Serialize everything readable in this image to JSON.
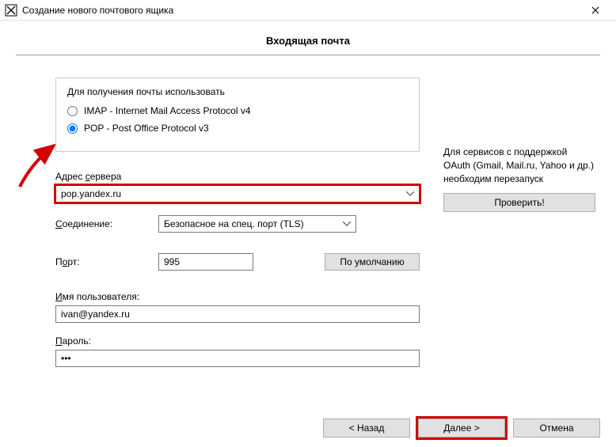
{
  "titlebar": {
    "title": "Создание нового почтового ящика"
  },
  "section": {
    "heading": "Входящая почта"
  },
  "protocol": {
    "legend": "Для получения почты использовать",
    "imap_label": "IMAP - Internet Mail Access Protocol v4",
    "pop_label": "POP  -  Post Office Protocol v3",
    "selected": "pop"
  },
  "server": {
    "label_prefix": "Адрес ",
    "label_underlined": "с",
    "label_suffix": "ервера",
    "value": "pop.yandex.ru"
  },
  "connection": {
    "label_underlined": "С",
    "label_suffix": "оединение:",
    "value": "Безопасное на спец. порт (TLS)"
  },
  "port": {
    "label_prefix": "П",
    "label_underlined": "о",
    "label_suffix": "рт:",
    "value": "995",
    "default_button": "По умолчанию"
  },
  "username": {
    "label_underlined": "И",
    "label_suffix": "мя пользователя:",
    "value": "ivan@yandex.ru"
  },
  "password": {
    "label_underlined": "П",
    "label_suffix": "ароль:",
    "value": "•••"
  },
  "hint": {
    "text": "Для сервисов с поддержкой OAuth (Gmail, Mail.ru, Yahoo и др.) необходим перезапуск",
    "check_button": "Проверить!"
  },
  "footer": {
    "back": "<   Назад",
    "next": "Далее   >",
    "cancel": "Отмена"
  }
}
